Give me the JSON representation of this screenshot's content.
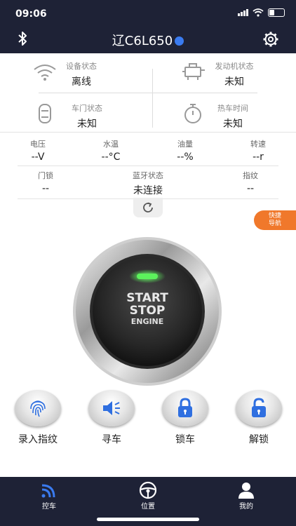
{
  "status_bar": {
    "time": "09:06"
  },
  "header": {
    "title": "辽C6L650"
  },
  "info": {
    "device_status": {
      "label": "设备状态",
      "value": "离线"
    },
    "engine_status": {
      "label": "发动机状态",
      "value": "未知"
    },
    "door_status": {
      "label": "车门状态",
      "value": "未知"
    },
    "warmup_time": {
      "label": "热车时间",
      "value": "未知"
    }
  },
  "metrics": [
    {
      "label": "电压",
      "value": "--V"
    },
    {
      "label": "水温",
      "value": "--°C"
    },
    {
      "label": "油量",
      "value": "--%"
    },
    {
      "label": "转速",
      "value": "--r"
    }
  ],
  "bt_row": {
    "door_lock": {
      "label": "门锁",
      "value": "--"
    },
    "bluetooth": {
      "label": "蓝牙状态",
      "value": "未连接"
    },
    "fingerprint": {
      "label": "指纹",
      "value": "--"
    }
  },
  "quick_nav": {
    "line1": "快捷",
    "line2": "导航"
  },
  "engine_button": {
    "line1": "START",
    "line2": "STOP",
    "line3": "ENGINE",
    "led_color": "#5cf25c"
  },
  "actions": [
    {
      "label": "录入指纹",
      "icon": "fingerprint-icon"
    },
    {
      "label": "寻车",
      "icon": "speaker-icon"
    },
    {
      "label": "锁车",
      "icon": "lock-icon"
    },
    {
      "label": "解锁",
      "icon": "unlock-icon"
    }
  ],
  "tabs": [
    {
      "label": "控车",
      "icon": "signal-waves-icon",
      "active": true
    },
    {
      "label": "位置",
      "icon": "steering-wheel-icon",
      "active": false
    },
    {
      "label": "我的",
      "icon": "person-icon",
      "active": false
    }
  ],
  "colors": {
    "navy": "#1e2236",
    "accent_blue": "#3a7bf0",
    "quick_nav_orange": "#f0782b"
  }
}
